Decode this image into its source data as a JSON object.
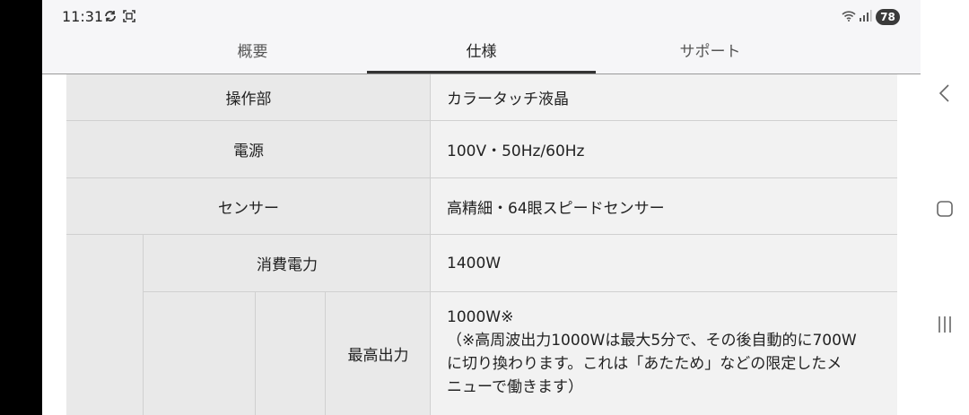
{
  "status_bar": {
    "time": "11:31",
    "battery": "78",
    "icons": [
      "sync-icon",
      "screenshot-icon",
      "wifi-icon",
      "signal-icon"
    ]
  },
  "tabs": [
    {
      "label": "概要"
    },
    {
      "label": "仕様",
      "active": true
    },
    {
      "label": "サポート"
    }
  ],
  "specs": {
    "control": {
      "label": "操作部",
      "value": "カラータッチ液晶"
    },
    "power": {
      "label": "電源",
      "value": "100V・50Hz/60Hz"
    },
    "sensor": {
      "label": "センサー",
      "value": "高精細・64眼スピードセンサー"
    },
    "consumption": {
      "label": "消費電力",
      "value": "1400W"
    },
    "max_output": {
      "label": "最高出力",
      "lines": [
        "1000W※",
        "（※高周波出力1000Wは最大5分で、その後自動的に700W",
        "に切り換わります。これは「あたため」などの限定したメ",
        "ニューで働きます）"
      ]
    }
  },
  "nav": {
    "icons": [
      "back-icon",
      "home-icon",
      "recents-icon"
    ]
  }
}
